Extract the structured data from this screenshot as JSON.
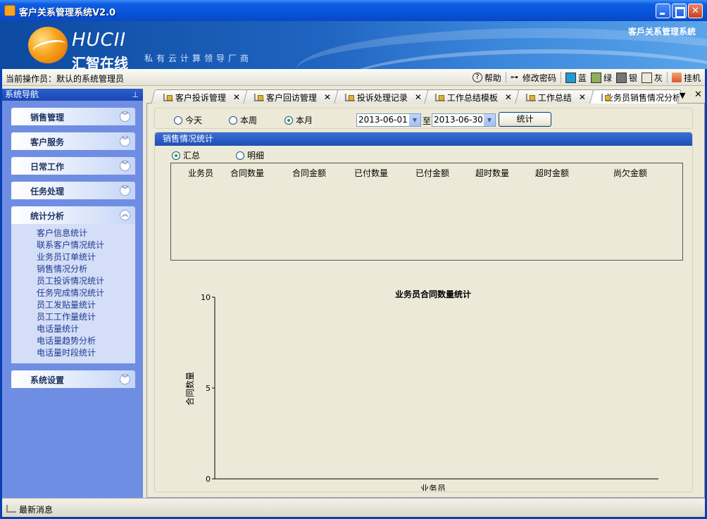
{
  "window": {
    "title": "客户关系管理系统V2.0"
  },
  "banner": {
    "logo_en": "HUCII",
    "logo_cn": "汇智在线",
    "slogan": "私有云计算领导厂商",
    "system_name": "客戶关系管理系統"
  },
  "operator_bar": {
    "operator": "当前操作员：默认的系统管理员",
    "help": "帮助",
    "change_password": "修改密码",
    "themes": [
      {
        "label": "蓝",
        "color": "#1e9ad6"
      },
      {
        "label": "绿",
        "color": "#8fae5a"
      },
      {
        "label": "银",
        "color": "#767676"
      },
      {
        "label": "灰",
        "color": "#ece9d8"
      }
    ],
    "hangup": "挂机"
  },
  "sidebar": {
    "title": "系统导航",
    "groups": [
      {
        "label": "销售管理",
        "open": false
      },
      {
        "label": "客户服务",
        "open": false
      },
      {
        "label": "日常工作",
        "open": false
      },
      {
        "label": "任务处理",
        "open": false
      },
      {
        "label": "统计分析",
        "open": true,
        "items": [
          "客户信息统计",
          "联系客户情况统计",
          "业务员订单统计",
          "销售情况分析",
          "员工投诉情况统计",
          "任务完成情况统计",
          "员工发贴量统计",
          "员工工作量统计",
          "电话量统计",
          "电话量趋势分析",
          "电话量时段统计"
        ]
      },
      {
        "label": "系统设置",
        "open": false
      }
    ]
  },
  "tabs": [
    "客户投诉管理",
    "客户回访管理",
    "投诉处理记录",
    "工作总结模板",
    "工作总结",
    "业务员销售情况分析"
  ],
  "active_tab": 5,
  "filter": {
    "ranges": [
      "今天",
      "本周",
      "本月"
    ],
    "selected_range": "本月",
    "start_date": "2013-06-01",
    "to": "至",
    "end_date": "2013-06-30",
    "button": "统计"
  },
  "panel": {
    "title": "销售情况统计",
    "views": [
      "汇总",
      "明细"
    ],
    "selected_view": "汇总",
    "columns": [
      "业务员",
      "合同数量",
      "合同金额",
      "已付数量",
      "已付金额",
      "超时数量",
      "超时金额",
      "尚欠金额"
    ]
  },
  "chart_data": {
    "type": "bar",
    "title": "业务员合同数量统计",
    "xlabel": "业务员",
    "ylabel": "合同数量",
    "categories": [],
    "values": [],
    "ylim": [
      0,
      10
    ],
    "yticks": [
      0,
      5,
      10
    ],
    "grid": false
  },
  "status": {
    "label": "最新消息"
  }
}
